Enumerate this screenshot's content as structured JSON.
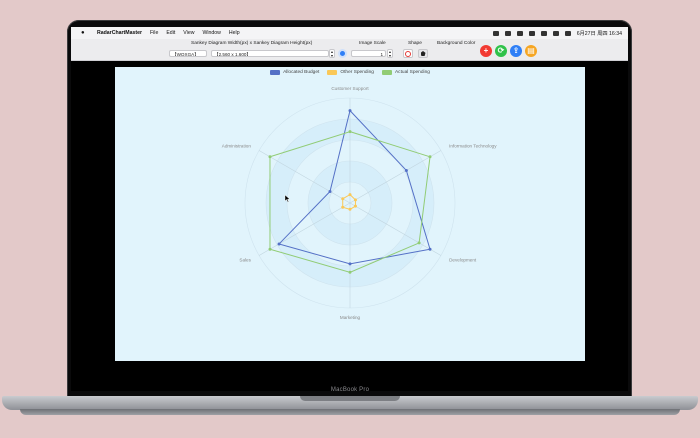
{
  "menubar": {
    "apple": "",
    "app_name": "RadarChartMaster",
    "items": [
      "File",
      "Edit",
      "View",
      "Window",
      "Help"
    ],
    "clock": "6月27日 周四  16:34"
  },
  "toolbar": {
    "size_label": "Sankey Diagram Width(px)  x  Sankey Diagram Height(px)",
    "preset_value": "【WQXGA】  ",
    "size_value": "【2,560 x 1,600】",
    "scale_label": "Image Scale",
    "scale_value": "1",
    "shape_label": "Shape",
    "bg_label": "Background Color",
    "add_glyph": "+",
    "refresh_glyph": "⟳",
    "share_glyph": "⇪",
    "export_glyph": "▤"
  },
  "device": {
    "brand": "MacBook Pro"
  },
  "chart_data": {
    "type": "radar",
    "axes": [
      "Customer Support",
      "Information Technology",
      "Development",
      "Marketing",
      "Sales",
      "Administration"
    ],
    "series": [
      {
        "name": "Allocated Budget",
        "color": "#5470c6",
        "values": [
          88,
          62,
          88,
          58,
          78,
          22
        ]
      },
      {
        "name": "Other Spending",
        "color": "#fac858",
        "values": [
          8,
          6,
          6,
          6,
          8,
          8
        ]
      },
      {
        "name": "Actual Spending",
        "color": "#91cc75",
        "values": [
          68,
          88,
          76,
          66,
          88,
          88
        ]
      }
    ],
    "max": 100,
    "legend_position": "top-center"
  }
}
